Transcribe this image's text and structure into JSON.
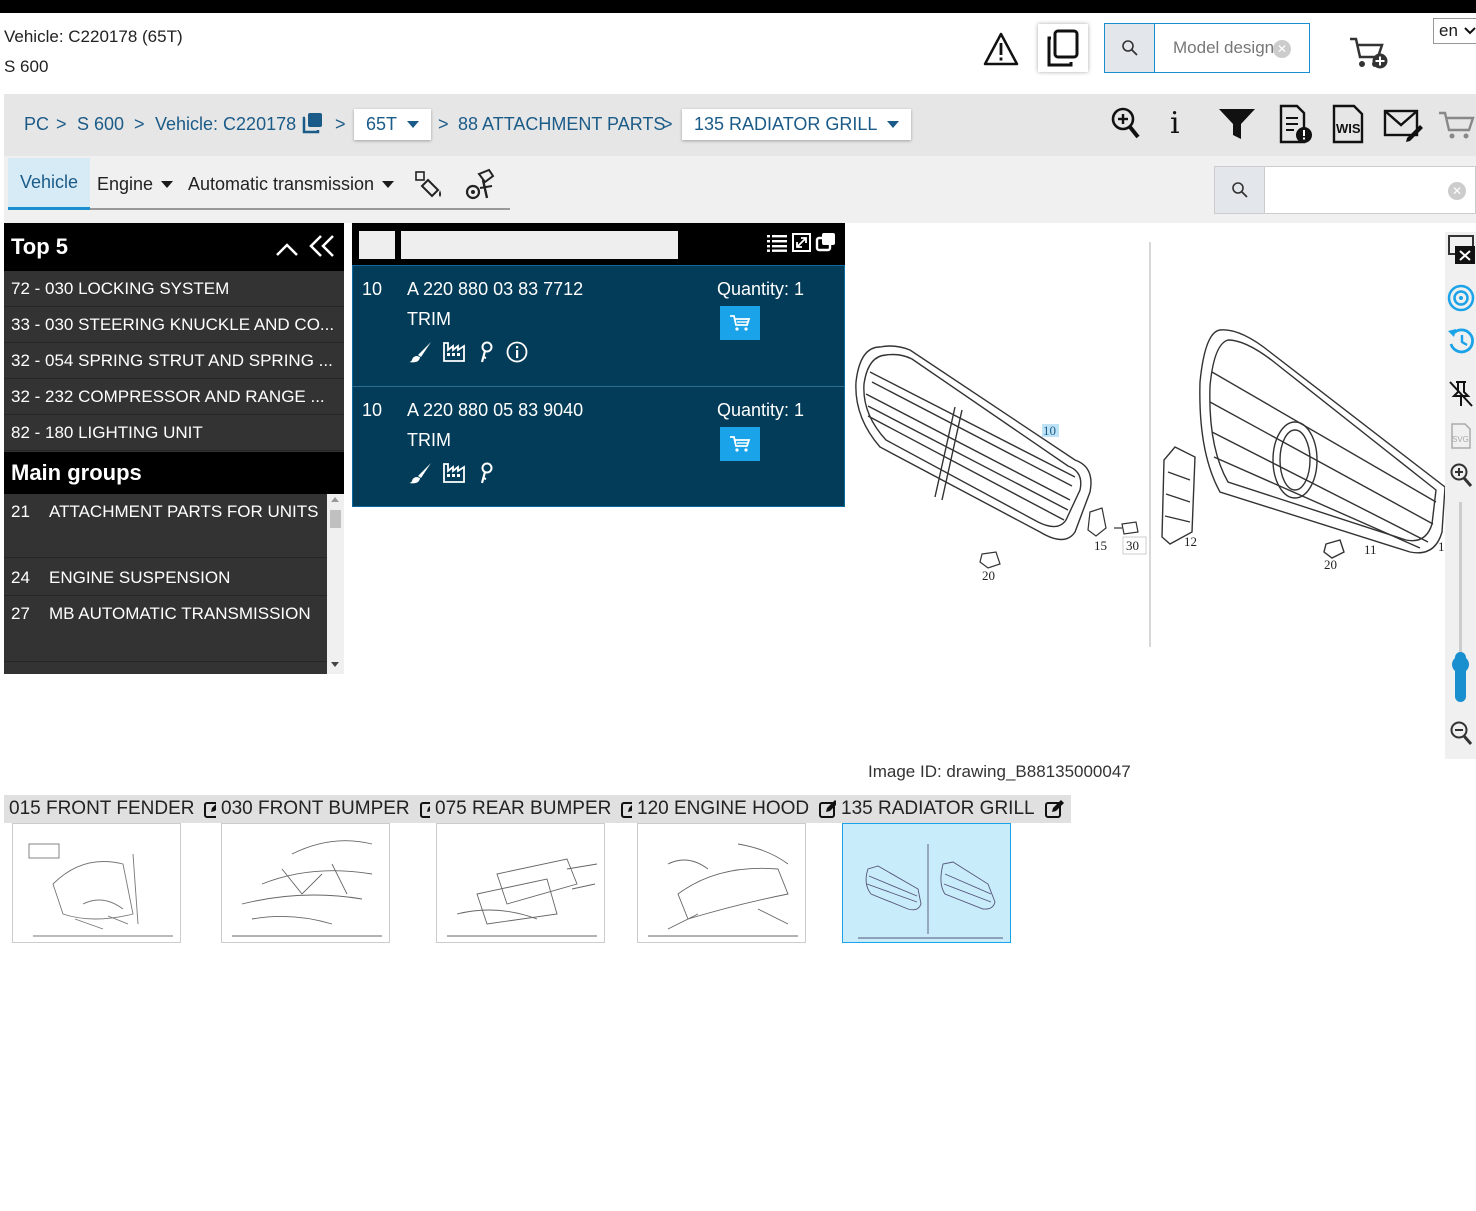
{
  "vehicle": {
    "line1": "Vehicle: C220178 (65T)",
    "line2": "S 600"
  },
  "header": {
    "model_search_placeholder": "Model design",
    "language": "en"
  },
  "breadcrumb": {
    "pc": "PC",
    "sep": ">",
    "model": "S 600",
    "vehicle": "Vehicle: C220178",
    "variant": "65T",
    "group": "88 ATTACHMENT PARTS",
    "subgroup": "135 RADIATOR GRILL"
  },
  "tabs": {
    "vehicle": "Vehicle",
    "engine": "Engine",
    "transmission": "Automatic transmission"
  },
  "top5": {
    "title": "Top 5",
    "items": [
      "72 - 030 LOCKING SYSTEM",
      "33 - 030 STEERING KNUCKLE AND CO...",
      "32 - 054 SPRING STRUT AND SPRING ...",
      "32 - 232 COMPRESSOR AND RANGE ...",
      "82 - 180 LIGHTING UNIT"
    ]
  },
  "main_groups": {
    "title": "Main groups",
    "items": [
      {
        "num": "21",
        "label": "ATTACHMENT PARTS FOR UNITS"
      },
      {
        "num": "24",
        "label": "ENGINE SUSPENSION"
      },
      {
        "num": "27",
        "label": "MB AUTOMATIC TRANSMISSION"
      }
    ]
  },
  "parts": [
    {
      "pos": "10",
      "number": "A 220 880 03 83 7712",
      "desc": "TRIM",
      "quantity": "Quantity: 1"
    },
    {
      "pos": "10",
      "number": "A 220 880 05 83 9040",
      "desc": "TRIM",
      "quantity": "Quantity: 1"
    }
  ],
  "drawing": {
    "labels_left": [
      "10",
      "15",
      "30",
      "20"
    ],
    "labels_right": [
      "12",
      "20",
      "11",
      "1"
    ],
    "image_id": "Image ID: drawing_B88135000047"
  },
  "thumbnails": [
    {
      "label": "015 FRONT FENDER"
    },
    {
      "label": "030 FRONT BUMPER"
    },
    {
      "label": "075 REAR BUMPER"
    },
    {
      "label": "120 ENGINE HOOD"
    },
    {
      "label": "135 RADIATOR GRILL"
    }
  ],
  "colors": {
    "accent": "#1aa3e8",
    "parts_bg": "#023c58",
    "link": "#1b5b88"
  }
}
